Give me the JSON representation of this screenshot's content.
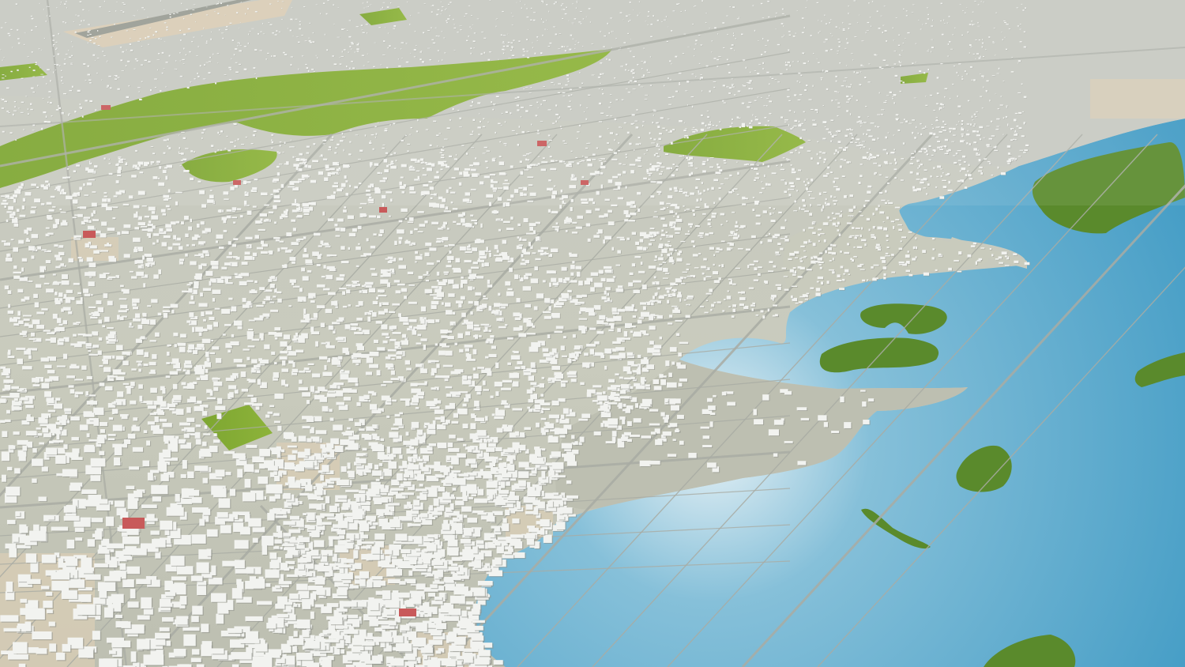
{
  "scene": {
    "view": "aerial-3d-city-model",
    "colors": {
      "land": "#bdbfb1",
      "land_light": "#c9cbbd",
      "land_far": "#c7c9c2",
      "sand": "#d9cdb6",
      "sea_light": "#e8f2f6",
      "sea_mid": "#86c0d9",
      "sea_deep": "#3f9ac4",
      "park_light": "#8db33a",
      "park": "#7da631",
      "island": "#5a8a2c",
      "block": "#f2f3f0",
      "block_shadow": "#8e9089",
      "road": "#a9aca4",
      "roof_red": "#c85a5a"
    },
    "regions": [
      {
        "name": "sea",
        "kind": "water"
      },
      {
        "name": "reclaimed-peninsula",
        "kind": "land"
      },
      {
        "name": "old-town-dense",
        "kind": "urban"
      },
      {
        "name": "grid-city",
        "kind": "urban"
      },
      {
        "name": "north-city",
        "kind": "urban"
      },
      {
        "name": "river-park-strip",
        "kind": "park"
      },
      {
        "name": "airport",
        "kind": "infrastructure"
      }
    ],
    "islands": [
      {
        "name": "island-upper-small"
      },
      {
        "name": "island-upper-long"
      },
      {
        "name": "island-middle"
      },
      {
        "name": "island-reef-strip"
      },
      {
        "name": "island-far-east"
      },
      {
        "name": "island-bottom-right"
      }
    ],
    "parks": [
      {
        "name": "park-river-corridor"
      },
      {
        "name": "park-north-top"
      },
      {
        "name": "park-left-west"
      },
      {
        "name": "park-east-fields"
      },
      {
        "name": "park-southwest-square"
      }
    ]
  }
}
